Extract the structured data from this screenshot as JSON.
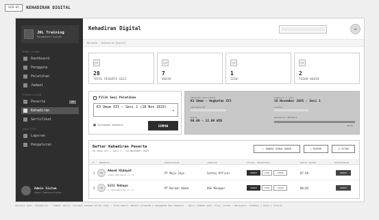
{
  "screen": {
    "tag": "SCR-07",
    "title": "KEHADIRAN DIGITAL"
  },
  "sidebar": {
    "brand_name": "JRL Training",
    "brand_sub": "Management System",
    "section_main": "MENU UTAMA",
    "section_training": "PENGELOLAAN",
    "section_reports": "ANALITIK",
    "items": [
      {
        "label": "Dashboard"
      },
      {
        "label": "Pengguna"
      },
      {
        "label": "Pelatihan"
      },
      {
        "label": "Jadwal"
      },
      {
        "label": "Peserta",
        "badge": "28"
      },
      {
        "label": "Kehadiran"
      },
      {
        "label": "Sertifikat"
      },
      {
        "label": "Laporan"
      },
      {
        "label": "Pengaturan"
      }
    ],
    "user": {
      "name": "Admin Sistem",
      "role": "Super Administrator"
    }
  },
  "header": {
    "title": "Kehadiran Digital",
    "avatar": "AD",
    "breadcrumb": "Beranda › Kehadiran Digital"
  },
  "stats": [
    {
      "icon": "icon",
      "value": "28",
      "label": "TOTAL PESERTA SESI"
    },
    {
      "icon": "icon",
      "value": "7",
      "label": "HADIR"
    },
    {
      "icon": "icon",
      "value": "1",
      "label": "IZIN"
    },
    {
      "icon": "icon",
      "value": "2",
      "label": "TIDAK HADIR"
    }
  ],
  "picker": {
    "title": "Pilih Sesi Pelatihan",
    "selected": "K3 Umum XII — Sesi 1 (18 Nov 2025)",
    "auto_save": "Tersimpan otomatis",
    "save_label": "SIMPAN"
  },
  "session": {
    "training_label": "PROGRAM PELATIHAN",
    "training_value": "K3 Umum - Angkatan XII",
    "date_label": "TANGGAL & SESI",
    "date_value": "18 November 2025 - Sesi 1",
    "instructor_label": "INSTRUKTUR",
    "time_label": "WAKTU",
    "time_value": "08.00 - 12.00 WIB",
    "location_label": "LOKASI",
    "progress_label": "PROGRESS ABSENSI",
    "progress_text": "28/28",
    "progress_fraction": 1.0
  },
  "list": {
    "title": "Daftar Kehadiran Peserta",
    "subtitle": "K3 Umum XII — Sesi 1 · 18 November 2025",
    "btn_all_present": "✓ TANDAI SEMUA HADIR",
    "btn_export": "⤓ EKSPOR",
    "btn_print": "⎙ CETAK",
    "headers": [
      "#",
      "PESERTA",
      "PERUSAHAAN",
      "JABATAN",
      "STATUS KEHADIRAN",
      "WAKTU MASUK",
      "KETERANGAN"
    ],
    "rows": [
      {
        "no": "1",
        "initials": "AH",
        "name": "Ahmad Hidayat",
        "email": "ahmad.h@pramaja.co.id",
        "company": "PT Maju Jaya",
        "position": "Safety Officer",
        "chips": [
          "HADIR",
          "IZIN",
          "TIDAK"
        ],
        "time": "07:58",
        "note": "HADIR"
      },
      {
        "no": "2",
        "initials": "SR",
        "name": "Siti Rahayu",
        "email": "s.rahayu@berkah.co.id",
        "company": "PT Berkah Abadi",
        "position": "HSE Manager",
        "chips": [
          "HADIR",
          "IZIN",
          "TIDAK"
        ],
        "time": "08:03",
        "note": "HADIR"
      }
    ]
  },
  "footer": "Anotasi user: Kehadiran · Tombol aktif: diinput dengan pilih sesi · Info audit: detail program / pengguna dan absensi · Aksi: tombol pdf, xlsx, cetak · Navigasi: sidebar | Data / Status"
}
